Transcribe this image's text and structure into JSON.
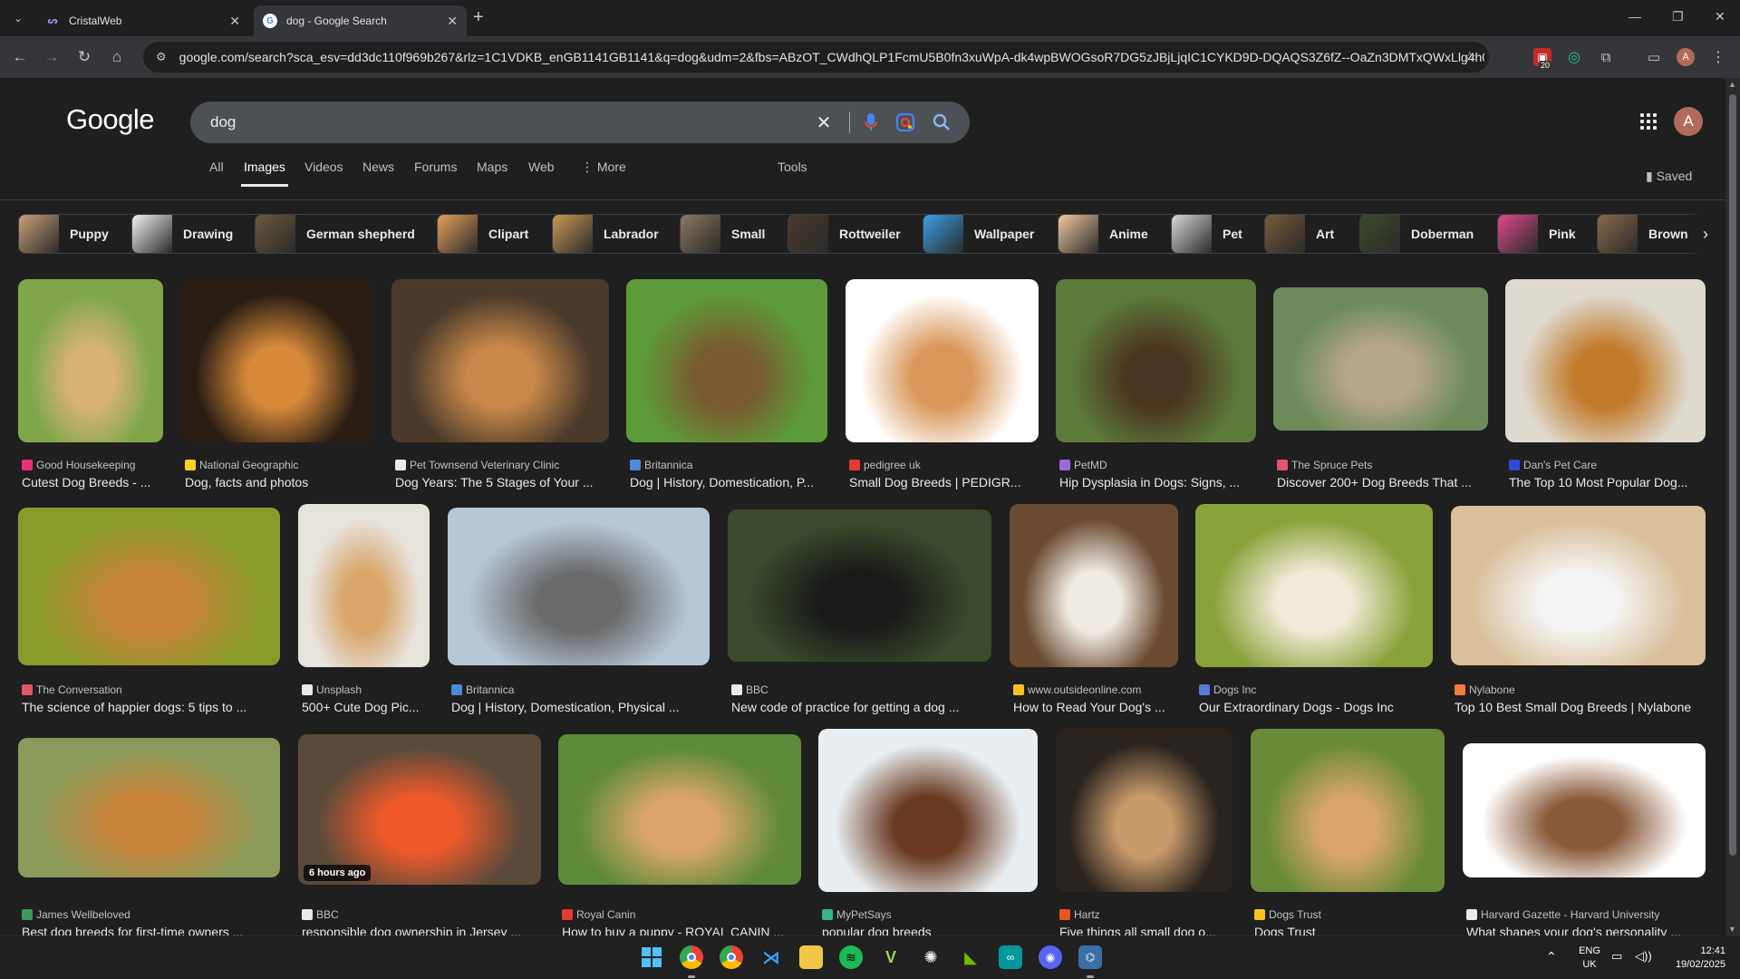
{
  "browser": {
    "tabs": [
      {
        "title": "CristalWeb",
        "active": false,
        "fav_color": "#7b61ff"
      },
      {
        "title": "dog - Google Search",
        "active": true,
        "fav_color": "#4285f4"
      }
    ],
    "url": "google.com/search?sca_esv=dd3dc110f969b267&rlz=1C1VDKB_enGB1141GB1141&q=dog&udm=2&fbs=ABzOT_CWdhQLP1FcmU5B0fn3xuWpA-dk4wpBWOGsoR7DG5zJBjLjqIC1CYKD9D-DQAQS3Z6fZ--OaZn3DMTxQWxLlg4h0tZg...",
    "extension_badge": "20",
    "profile_initial": "A"
  },
  "google": {
    "logo": "Google",
    "query": "dog",
    "nav_tabs": [
      "All",
      "Images",
      "Videos",
      "News",
      "Forums",
      "Maps",
      "Web",
      "More",
      "Tools"
    ],
    "active_tab": "Images",
    "saved_label": "Saved",
    "account_initial": "A"
  },
  "chips": [
    {
      "label": "Puppy",
      "color": "#c9a27a"
    },
    {
      "label": "Drawing",
      "color": "#f2f2f2"
    },
    {
      "label": "German shepherd",
      "color": "#6b5a3c"
    },
    {
      "label": "Clipart",
      "color": "#e8a05a"
    },
    {
      "label": "Labrador",
      "color": "#c99a52"
    },
    {
      "label": "Small",
      "color": "#8a7a60"
    },
    {
      "label": "Rottweiler",
      "color": "#4a3b2d"
    },
    {
      "label": "Wallpaper",
      "color": "#3aa0e8"
    },
    {
      "label": "Anime",
      "color": "#f0c9a0"
    },
    {
      "label": "Pet",
      "color": "#d8d8d8"
    },
    {
      "label": "Art",
      "color": "#7a5a3a"
    },
    {
      "label": "Doberman",
      "color": "#3e4a2e"
    },
    {
      "label": "Pink",
      "color": "#e04a8a"
    },
    {
      "label": "Brown",
      "color": "#8a6a4a"
    }
  ],
  "results": [
    {
      "source": "Good Housekeeping",
      "title": "Cutest Dog Breeds - ...",
      "fav": "#e8317a",
      "colors": [
        "#7fa74a",
        "#d9b27a"
      ],
      "badge": ""
    },
    {
      "source": "National Geographic",
      "title": "Dog, facts and photos",
      "fav": "#f7d21e",
      "colors": [
        "#2a1e14",
        "#d88a3a"
      ],
      "badge": ""
    },
    {
      "source": "Pet Townsend Veterinary Clinic",
      "title": "Dog Years: The 5 Stages of Your ...",
      "fav": "#e8eaed",
      "colors": [
        "#4a3a2a",
        "#c9894a"
      ],
      "badge": ""
    },
    {
      "source": "Britannica",
      "title": "Dog | History, Domestication, P...",
      "fav": "#4a8ad9",
      "colors": [
        "#5d9a3a",
        "#7a5a30"
      ],
      "badge": ""
    },
    {
      "source": "pedigree uk",
      "title": "Small Dog Breeds | PEDIGR...",
      "fav": "#e53935",
      "colors": [
        "#ffffff",
        "#d9975a"
      ],
      "badge": ""
    },
    {
      "source": "PetMD",
      "title": "Hip Dysplasia in Dogs: Signs, ...",
      "fav": "#9c6ad9",
      "colors": [
        "#5e7a3a",
        "#4a3620"
      ],
      "badge": ""
    },
    {
      "source": "The Spruce Pets",
      "title": "Discover 200+ Dog Breeds That ...",
      "fav": "#e0566a",
      "colors": [
        "#6c8a5a",
        "#b8a88a"
      ],
      "badge": ""
    },
    {
      "source": "Dan's Pet Care",
      "title": "The Top 10 Most Popular Dog...",
      "fav": "#2e4ad9",
      "colors": [
        "#dedad0",
        "#c27a2a"
      ],
      "badge": ""
    },
    {
      "source": "The Conversation",
      "title": "The science of happier dogs: 5 tips to ...",
      "fav": "#e0566a",
      "colors": [
        "#8a9a2a",
        "#c9843a"
      ],
      "badge": ""
    },
    {
      "source": "Unsplash",
      "title": "500+ Cute Dog Pic...",
      "fav": "#e8eaed",
      "colors": [
        "#e6e2dc",
        "#d9a56a"
      ],
      "badge": ""
    },
    {
      "source": "Britannica",
      "title": "Dog | History, Domestication, Physical ...",
      "fav": "#4a8ad9",
      "colors": [
        "#b7c7d6",
        "#6a6a6a"
      ],
      "badge": ""
    },
    {
      "source": "BBC",
      "title": "New code of practice for getting a dog ...",
      "fav": "#e8eaed",
      "colors": [
        "#3a4a2a",
        "#1a1a1a"
      ],
      "badge": ""
    },
    {
      "source": "www.outsideonline.com",
      "title": "How to Read Your Dog's ...",
      "fav": "#f7c21e",
      "colors": [
        "#6a4a30",
        "#f0ece4"
      ],
      "badge": ""
    },
    {
      "source": "Dogs Inc",
      "title": "Our Extraordinary Dogs - Dogs Inc",
      "fav": "#5a7ad9",
      "colors": [
        "#8aa23a",
        "#f2ead8"
      ],
      "badge": ""
    },
    {
      "source": "Nylabone",
      "title": "Top 10 Best Small Dog Breeds | Nylabone",
      "fav": "#f07a3a",
      "colors": [
        "#d9bf9a",
        "#f4f4f4"
      ],
      "badge": ""
    },
    {
      "source": "James Wellbeloved",
      "title": "Best dog breeds for first-time owners ...",
      "fav": "#3a9a5a",
      "colors": [
        "#8a9a5a",
        "#c9843a"
      ],
      "badge": ""
    },
    {
      "source": "BBC",
      "title": "responsible dog ownership in Jersey ...",
      "fav": "#e8eaed",
      "colors": [
        "#5a4a3a",
        "#f05a2a"
      ],
      "badge": "6 hours ago"
    },
    {
      "source": "Royal Canin",
      "title": "How to buy a puppy - ROYAL CANIN ...",
      "fav": "#e53935",
      "colors": [
        "#5e8a3a",
        "#d9a56a"
      ],
      "badge": ""
    },
    {
      "source": "MyPetSays",
      "title": "popular dog breeds",
      "fav": "#3ab08a",
      "colors": [
        "#e8eef2",
        "#6a3a22"
      ],
      "badge": ""
    },
    {
      "source": "Hartz",
      "title": "Five things all small dog o...",
      "fav": "#e8541e",
      "colors": [
        "#2a2420",
        "#c99a6a"
      ],
      "badge": ""
    },
    {
      "source": "Dogs Trust",
      "title": "Dogs Trust",
      "fav": "#f7c21e",
      "colors": [
        "#6a8a3a",
        "#d9a56a"
      ],
      "badge": ""
    },
    {
      "source": "Harvard Gazette - Harvard University",
      "title": "What shapes your dog's personality ...",
      "fav": "#e8eaed",
      "colors": [
        "#ffffff",
        "#8a5a3a"
      ],
      "badge": ""
    }
  ],
  "taskbar": {
    "language": "ENG",
    "region": "UK",
    "time": "12:41",
    "date": "19/02/2025"
  }
}
